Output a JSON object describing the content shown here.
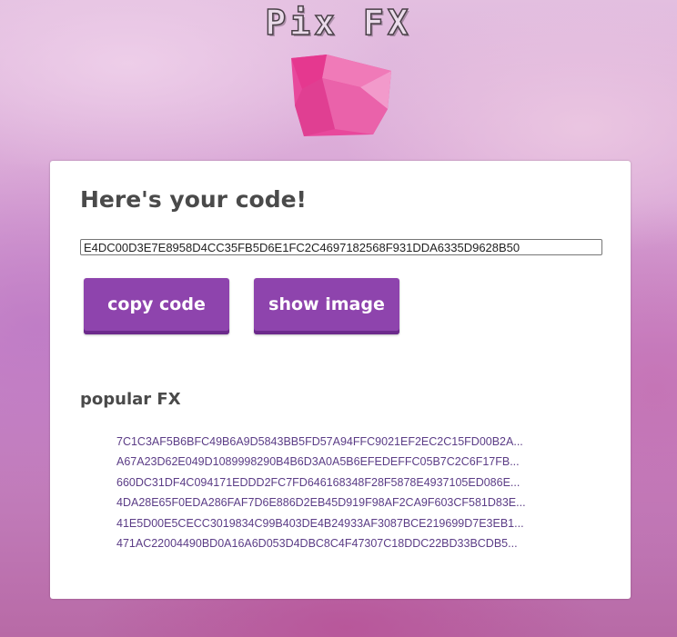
{
  "header": {
    "logo_text": "Pix FX"
  },
  "colors": {
    "accent": "#8e44ad",
    "gem": "#e8489c",
    "link": "#5b3c86"
  },
  "panel": {
    "heading": "Here's your code!",
    "code_value": "E4DC00D3E7E8958D4CC35FB5D6E1FC2C4697182568F931DDA6335D9628B50",
    "copy_label": "copy code",
    "show_label": "show image"
  },
  "popular": {
    "title": "popular FX",
    "items": [
      {
        "label": "7C1C3AF5B6BFC49B6A9D5843BB5FD57A94FFC9021EF2EC2C15FD00B2A..."
      },
      {
        "label": "A67A23D62E049D1089998290B4B6D3A0A5B6EFEDEFFC05B7C2C6F17FB..."
      },
      {
        "label": "660DC31DF4C094171EDDD2FC7FD646168348F28F5878E4937105ED086E..."
      },
      {
        "label": "4DA28E65F0EDA286FAF7D6E886D2EB45D919F98AF2CA9F603CF581D83E..."
      },
      {
        "label": "41E5D00E5CECC3019834C99B403DE4B24933AF3087BCE219699D7E3EB1..."
      },
      {
        "label": "471AC22004490BD0A16A6D053D4DBC8C4F47307C18DDC22BD33BCDB5..."
      }
    ]
  }
}
